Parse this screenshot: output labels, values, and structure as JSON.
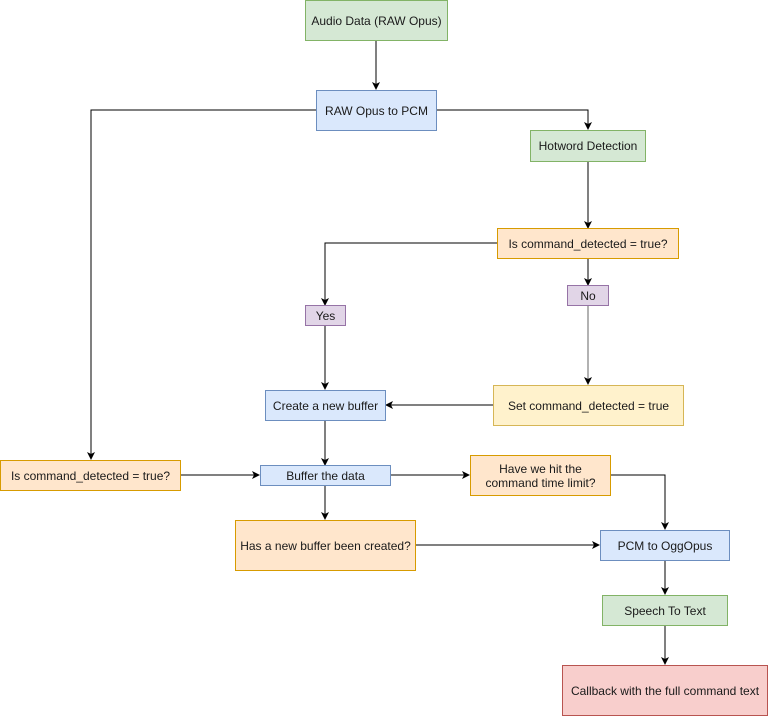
{
  "nodes": {
    "audio_data": "Audio Data (RAW Opus)",
    "raw_to_pcm": "RAW Opus to PCM",
    "hotword": "Hotword Detection",
    "is_cmd_top": "Is command_detected = true?",
    "yes": "Yes",
    "no": "No",
    "create_buffer": "Create a new buffer",
    "set_cmd": "Set command_detected = true",
    "is_cmd_left": "Is command_detected = true?",
    "buffer_data": "Buffer the data",
    "time_limit": "Have we hit the command time limit?",
    "new_buffer_created": "Has a new buffer been created?",
    "pcm_to_ogg": "PCM to OggOpus",
    "stt": "Speech To Text",
    "callback": "Callback with the full command text"
  },
  "colors": {
    "green": "#d5e8d4",
    "blue": "#dae8fc",
    "orange": "#ffe6cc",
    "yellow": "#fff2cc",
    "purple": "#e1d5e7",
    "red": "#f8cecc"
  }
}
